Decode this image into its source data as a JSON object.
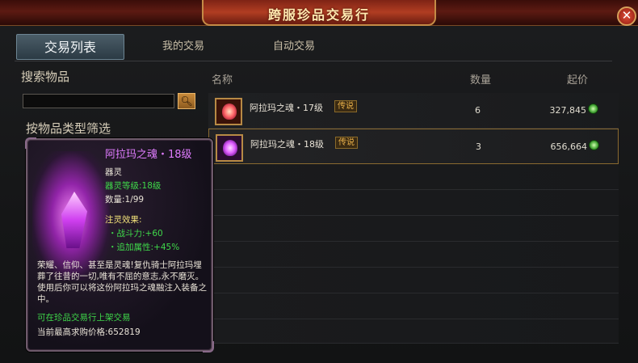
{
  "window": {
    "title": "跨服珍品交易行"
  },
  "tabs": [
    {
      "label": "交易列表",
      "active": true
    },
    {
      "label": "我的交易",
      "active": false
    },
    {
      "label": "自动交易",
      "active": false
    }
  ],
  "left": {
    "search_title": "搜索物品",
    "search_value": "",
    "filter_title": "按物品类型筛选"
  },
  "list": {
    "headers": {
      "name": "名称",
      "qty": "数量",
      "price": "起价"
    },
    "rows": [
      {
        "name": "阿拉玛之魂・17级",
        "grade": "传说",
        "qty": "6",
        "price": "327,845",
        "icon": "orange-soul-icon"
      },
      {
        "name": "阿拉玛之魂・18级",
        "grade": "传说",
        "qty": "3",
        "price": "656,664",
        "icon": "purple-soul-icon"
      }
    ]
  },
  "tooltip": {
    "title": "阿拉玛之魂・18级",
    "type": "器灵",
    "level": "器灵等级:18级",
    "count": "数量:1/99",
    "effect_label": "注灵效果:",
    "effect1": "・战斗力:+60",
    "effect2": "・追加属性:+45%",
    "desc": "荣耀、信仰、甚至是灵魂!复仇骑士阿拉玛埋葬了往昔的一切,唯有不屈的意志,永不磨灭。使用后你可以将这份阿拉玛之魂融注入装备之中。",
    "tradeable": "可在珍品交易行上架交易",
    "highest_bid": "当前最高求购价格:652819"
  },
  "colors": {
    "accent": "#c48b46",
    "legend": "#e07cff",
    "green": "#3fd84a"
  }
}
